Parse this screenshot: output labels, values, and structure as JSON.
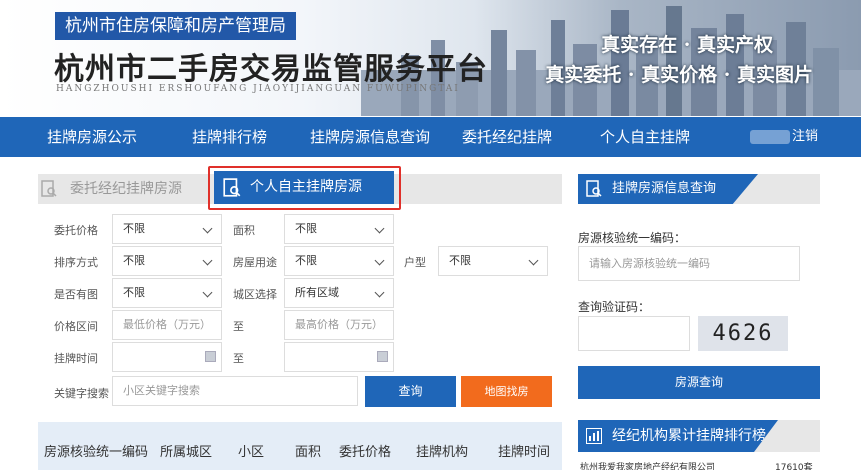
{
  "header": {
    "bureau": "杭州市住房保障和房产管理局",
    "platform_title": "杭州市二手房交易监管服务平台",
    "pinyin": "HANGZHOUSHI  ERSHOUFANG  JIAOYIJIANGUAN  FUWUPINGTAI",
    "slogan_line1": "真实存在 · 真实产权",
    "slogan_line2": "真实委托 · 真实价格 · 真实图片"
  },
  "nav": {
    "items": [
      "挂牌房源公示",
      "挂牌排行榜",
      "挂牌房源信息查询",
      "委托经纪挂牌",
      "个人自主挂牌"
    ],
    "logout": "注销"
  },
  "tabs": {
    "agent_listing": "委托经纪挂牌房源",
    "personal_listing": "个人自主挂牌房源"
  },
  "filters": {
    "commission_price": {
      "label": "委托价格",
      "value": "不限"
    },
    "area": {
      "label": "面积",
      "value": "不限"
    },
    "layout": {
      "label": "排序方式",
      "value": "不限"
    },
    "usage": {
      "label": "房屋用途",
      "value": "不限"
    },
    "house_type": {
      "label": "户型",
      "value": "不限"
    },
    "has_image": {
      "label": "是否有图",
      "value": "不限"
    },
    "district": {
      "label": "城区选择",
      "value": "所有区域"
    },
    "price_range": {
      "label": "价格区间",
      "min_placeholder": "最低价格（万元）",
      "to": "至",
      "max_placeholder": "最高价格（万元）"
    },
    "listing_time": {
      "label": "挂牌时间",
      "to": "至"
    },
    "keyword": {
      "label": "关键字搜索",
      "placeholder": "小区关键字搜索"
    },
    "query_button": "查询",
    "map_button": "地图找房"
  },
  "table": {
    "columns": [
      "房源核验统一编码",
      "所属城区",
      "小区",
      "面积",
      "委托价格",
      "挂牌机构",
      "挂牌时间"
    ]
  },
  "info_query": {
    "title": "挂牌房源信息查询",
    "code_label": "房源核验统一编码：",
    "code_placeholder": "请输入房源核验统一编码",
    "captcha_label": "查询验证码：",
    "captcha_text": "4626",
    "button": "房源查询"
  },
  "ranking": {
    "title": "经纪机构累计挂牌排行榜",
    "first_row_name": "杭州我爱我家房地产经纪有限公司",
    "first_row_value": "17610套"
  },
  "colors": {
    "primary": "#1f66b8",
    "highlight": "#e0302a",
    "orange": "#f26b1d"
  }
}
